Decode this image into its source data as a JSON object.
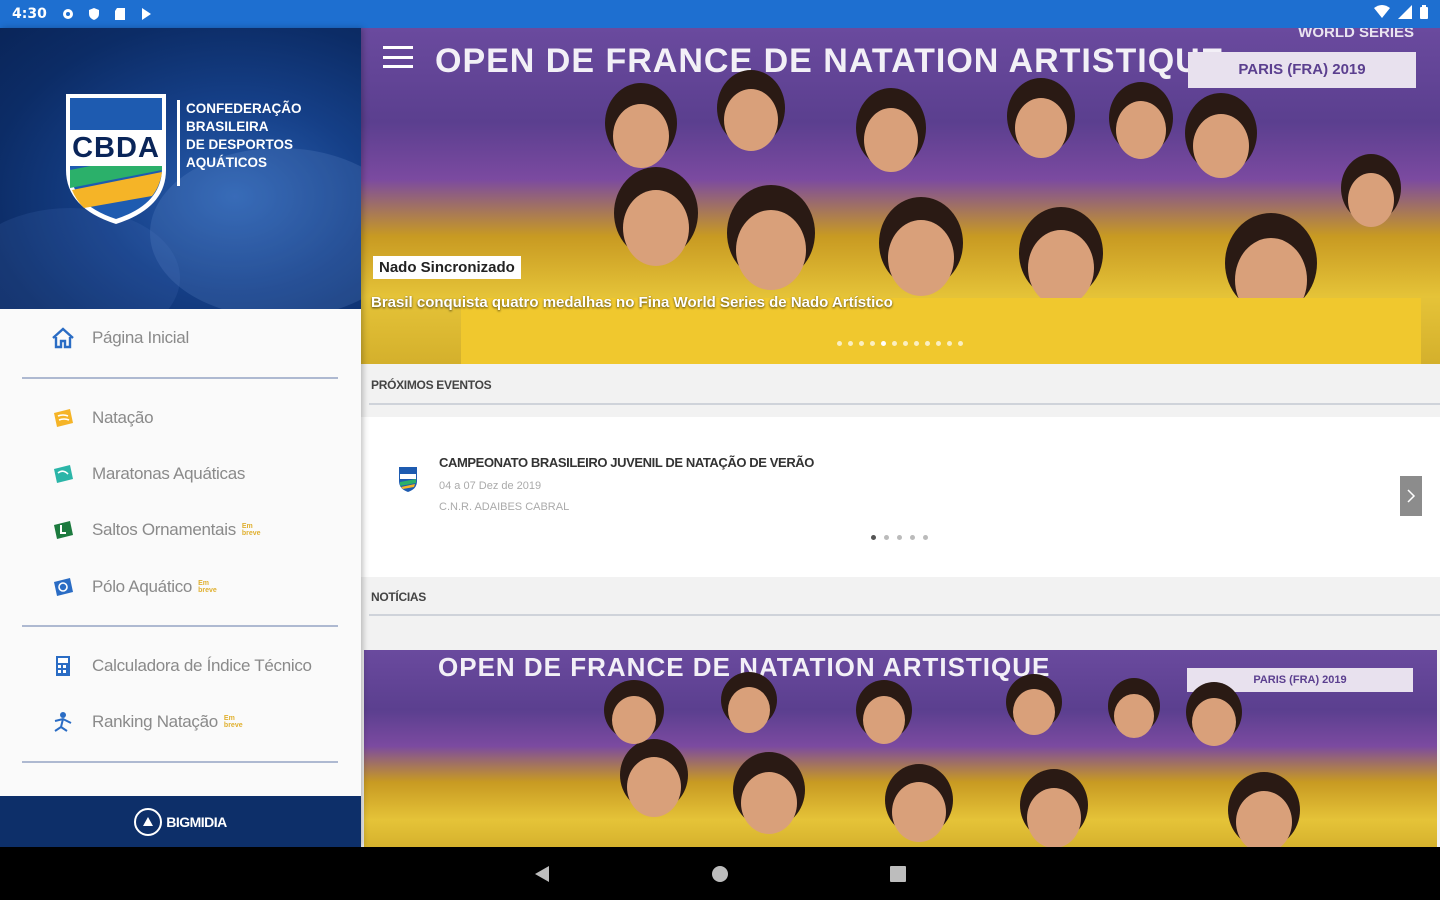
{
  "status_bar": {
    "time": "4:30"
  },
  "drawer": {
    "logo_text": "CBDA",
    "org_name_lines": [
      "Confederação",
      "Brasileira",
      "de Desportos",
      "Aquáticos"
    ],
    "items": [
      {
        "label": "Página Inicial",
        "icon": "home-icon",
        "icon_color": "#2a6cc4"
      },
      {
        "label": "Natação",
        "icon": "swimming-icon",
        "icon_color": "#f5b427"
      },
      {
        "label": "Maratonas Aquáticas",
        "icon": "marathon-icon",
        "icon_color": "#2bb5a8"
      },
      {
        "label": "Saltos Ornamentais",
        "icon": "diving-icon",
        "icon_color": "#1c7a3e",
        "badge": "Em breve"
      },
      {
        "label": "Pólo Aquático",
        "icon": "water-polo-icon",
        "icon_color": "#2a6cc4",
        "badge": "Em breve"
      },
      {
        "label": "Calculadora de Índice Técnico",
        "icon": "calculator-icon",
        "icon_color": "#2a6cc4"
      },
      {
        "label": "Ranking Natação",
        "icon": "ranking-icon",
        "icon_color": "#2a6cc4",
        "badge": "Em breve"
      }
    ],
    "footer": "BIGMIDIA"
  },
  "hero": {
    "banner": "OPEN DE FRANCE DE NATATION ARTISTIQUE",
    "world_series": "WORLD SERIES",
    "paris": "PARIS (FRA) 2019",
    "category": "Nado Sincronizado",
    "title": "Brasil conquista quatro medalhas no Fina World Series de Nado Artístico",
    "dot_count": 12
  },
  "events": {
    "section_label": "Próximos eventos",
    "title": "Campeonato Brasileiro Juvenil de Natação de Verão",
    "date": "04 a 07 Dez de 2019",
    "venue": "C.N.R. ADAIBES CABRAL",
    "dot_count": 5
  },
  "news": {
    "section_label": "Notícias",
    "banner": "OPEN DE FRANCE DE NATATION ARTISTIQUE",
    "paris": "PARIS (FRA) 2019"
  },
  "colors": {
    "status_bar": "#1e6fd0",
    "drawer_header": "#0c2c66",
    "footer": "#0d2f69",
    "badge": "#e0b030"
  }
}
